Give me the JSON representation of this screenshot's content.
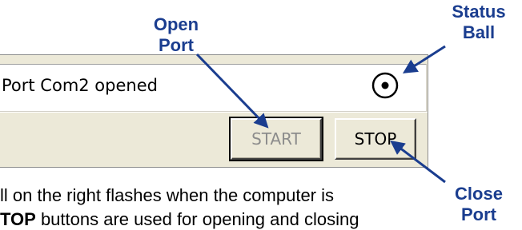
{
  "status_bar": {
    "text": "Port Com2 opened"
  },
  "buttons": {
    "start_label": "START",
    "stop_label": "STOP"
  },
  "callouts": {
    "open_port": [
      "Open",
      "Port"
    ],
    "status_ball": [
      "Status",
      "Ball"
    ],
    "close_port": [
      "Close",
      "Port"
    ]
  },
  "body": {
    "line1": "ll on the right flashes when the computer is",
    "line2_bold": "TOP",
    "line2_rest": " buttons are used for opening and closing"
  },
  "colors": {
    "callout": "#1a3d8f",
    "panel": "#ece9d8",
    "disabled_text": "#8c8c8c"
  },
  "icons": {
    "status": "status-ball-icon"
  }
}
